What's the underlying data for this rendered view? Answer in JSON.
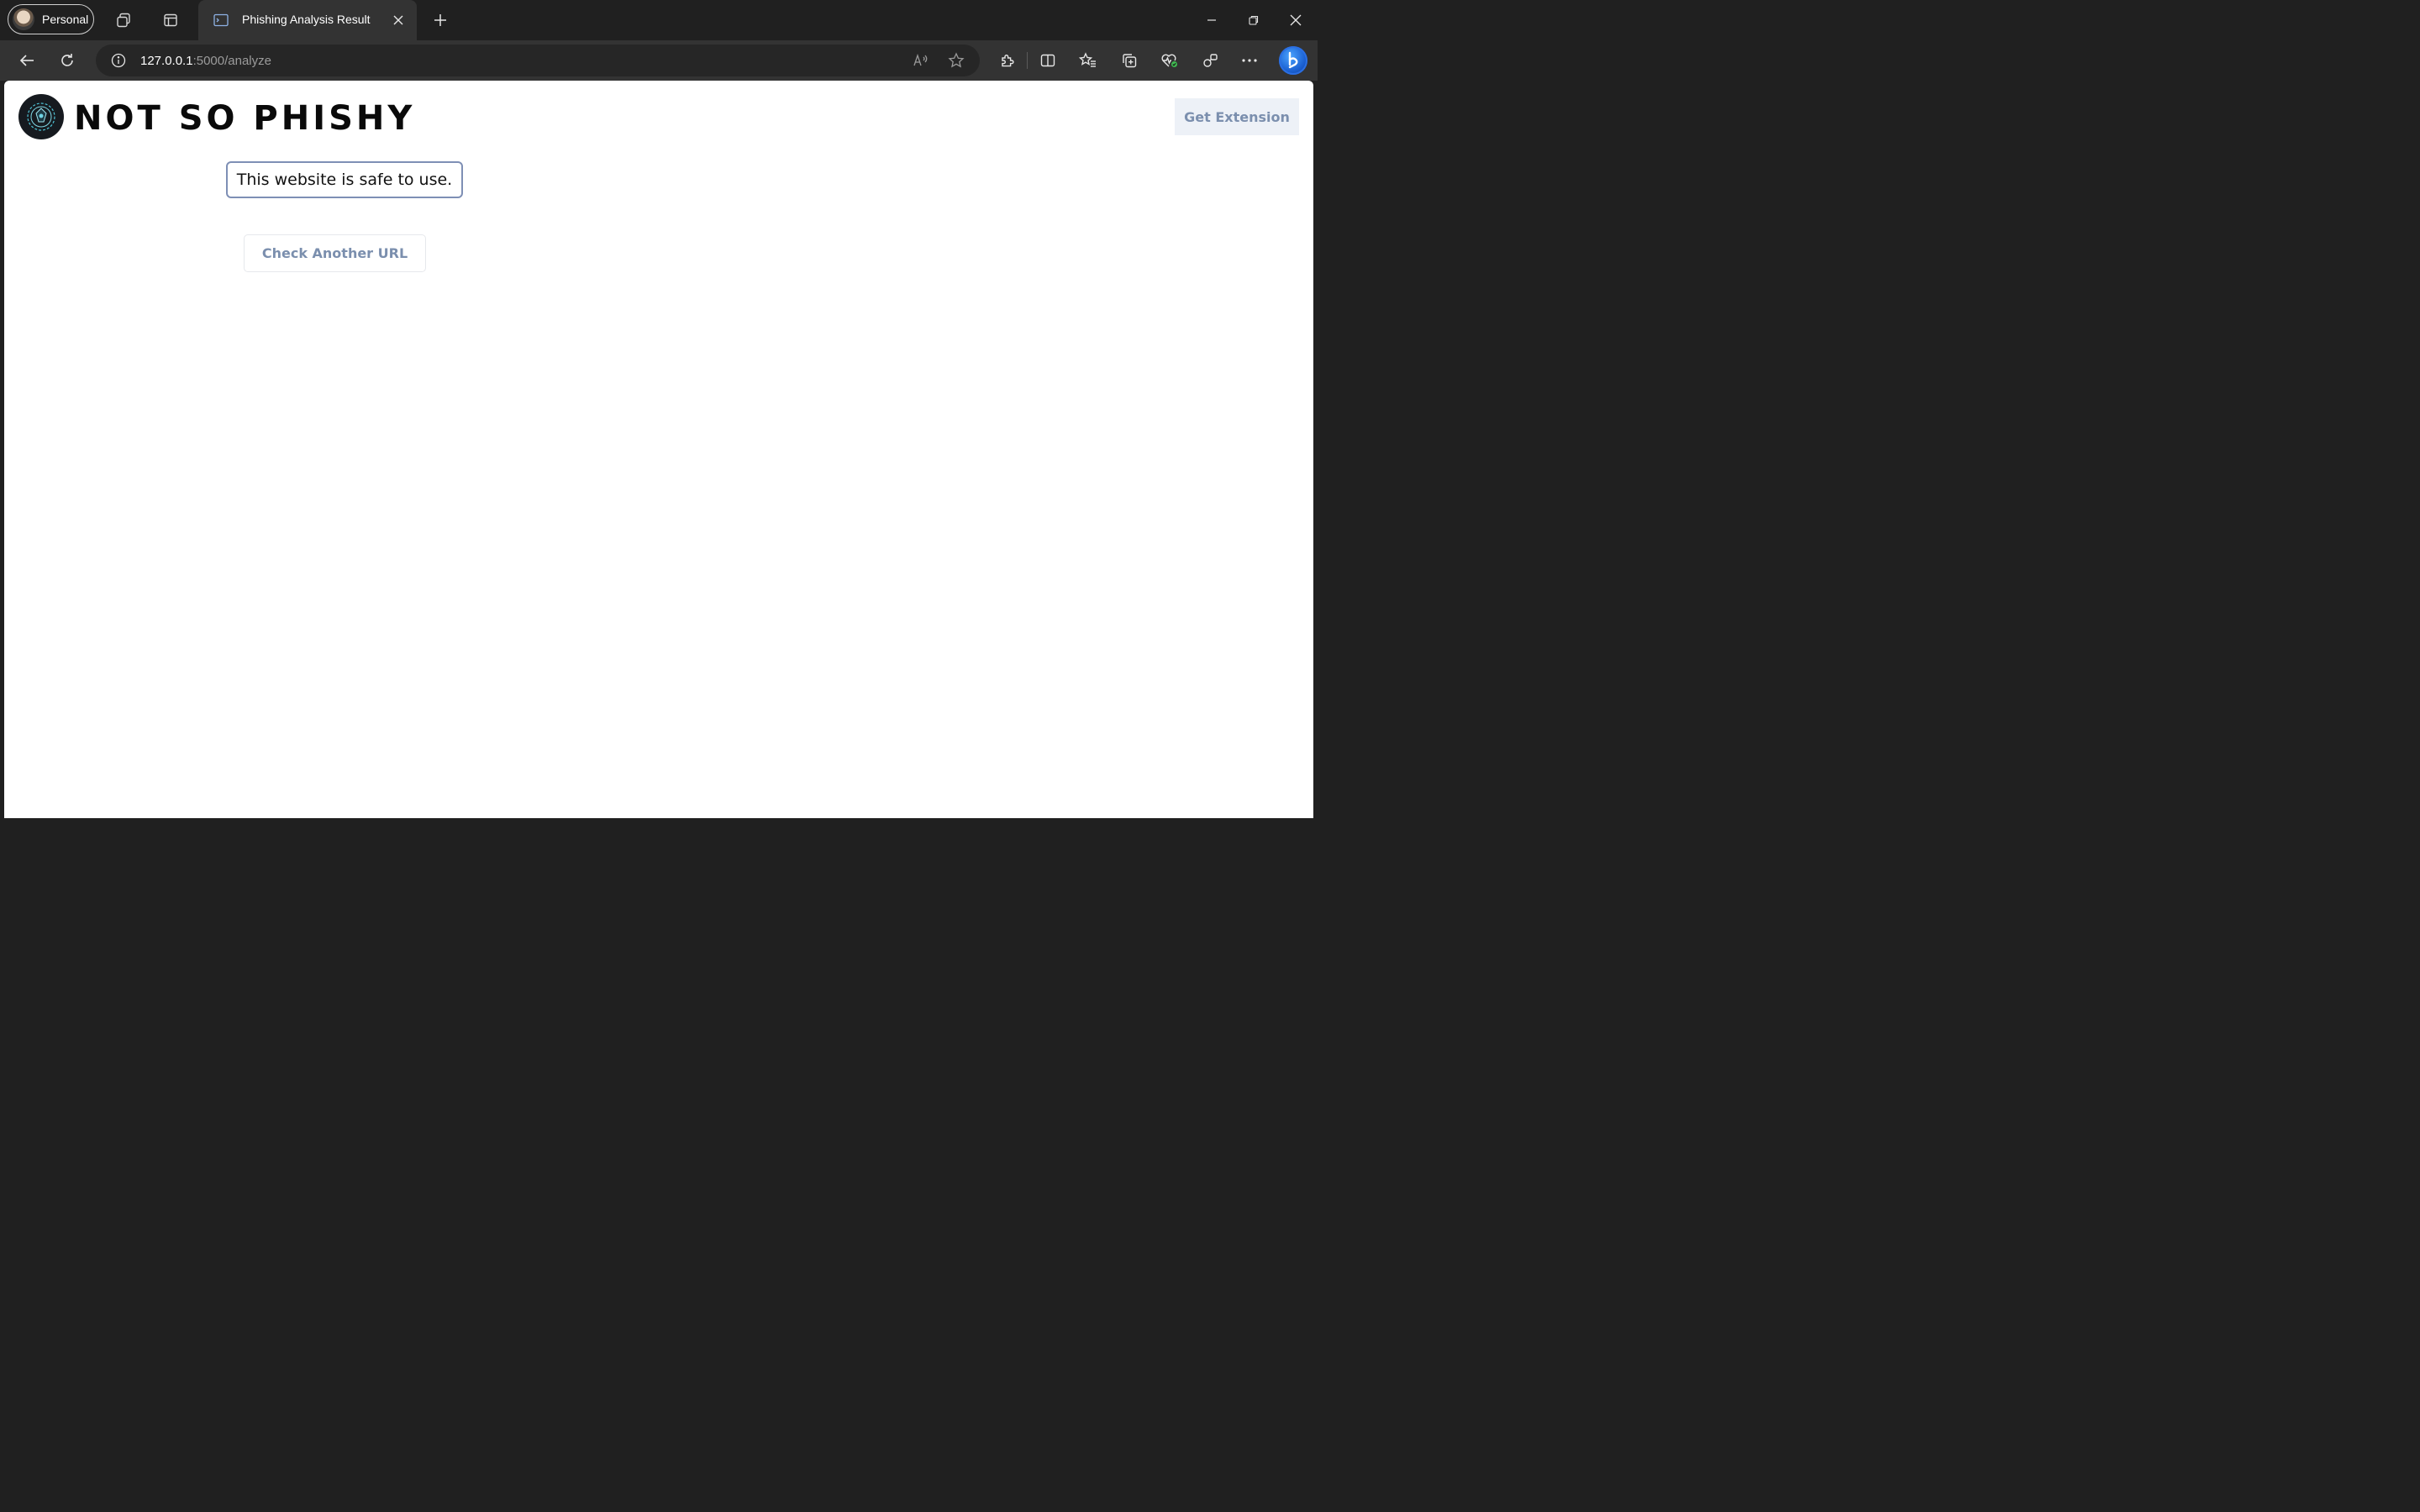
{
  "browser": {
    "profile": {
      "label": "Personal"
    },
    "tab": {
      "title": "Phishing Analysis Result"
    },
    "address": {
      "host": "127.0.0.1",
      "path": ":5000/analyze"
    }
  },
  "page": {
    "brand": "NOT SO PHISHY",
    "get_extension_label": "Get Extension",
    "result_text": "This website is safe to use.",
    "check_another_label": "Check Another URL"
  },
  "colors": {
    "accent_text": "#7b8fae",
    "result_border": "#7e8fb5",
    "browser_bg": "#202020",
    "toolbar_bg": "#333333"
  }
}
